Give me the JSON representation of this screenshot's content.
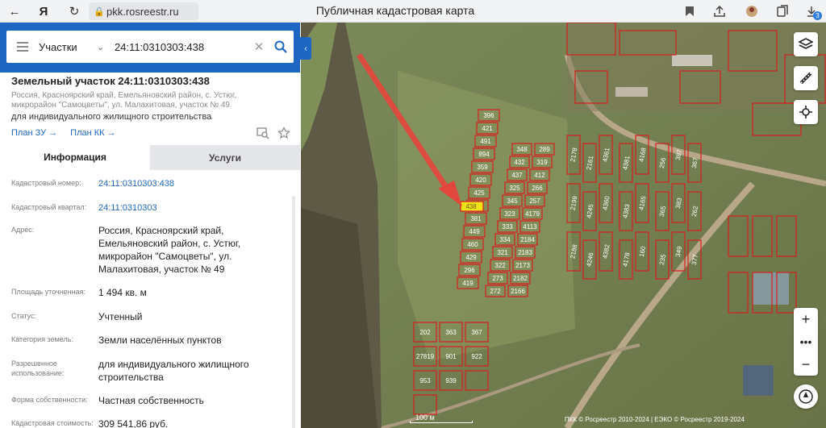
{
  "browser": {
    "url": "pkk.rosreestr.ru",
    "title": "Публичная кадастровая карта",
    "downloads_badge": "3"
  },
  "search": {
    "type_label": "Участки",
    "query": "24:11:0310303:438"
  },
  "parcel": {
    "title": "Земельный участок 24:11:0310303:438",
    "address_full": "Россия, Красноярский край, Емельяновский район, с. Устюг, микрорайон \"Самоцветы\", ул. Малахитовая, участок № 49",
    "permitted_use": "для индивидуального жилищного строительства",
    "plan_zu": "План ЗУ",
    "plan_kk": "План КК"
  },
  "tabs": {
    "info": "Информация",
    "services": "Услуги"
  },
  "info": [
    {
      "label": "Кадастровый номер:",
      "value": "24:11:0310303:438"
    },
    {
      "label": "Кадастровый квартал:",
      "value": "24:11:0310303"
    },
    {
      "label": "Адрес:",
      "value": "Россия, Красноярский край, Емельяновский район, с. Устюг, микрорайон \"Самоцветы\", ул. Малахитовая, участок № 49"
    },
    {
      "label": "Площадь уточненная:",
      "value": "1 494 кв. м"
    },
    {
      "label": "Статус:",
      "value": "Учтенный"
    },
    {
      "label": "Категория земель:",
      "value": "Земли населённых пунктов"
    },
    {
      "label": "Разрешенное использование:",
      "value": "для индивидуального жилищного строительства"
    },
    {
      "label": "Форма собственности:",
      "value": "Частная собственность"
    },
    {
      "label": "Кадастровая стоимость:",
      "value": "309 541,86 руб."
    }
  ],
  "map": {
    "scale_label": "100 м",
    "copyright": "ПКК © Росреестр 2010-2024 | ЕЭКО © Росреестр 2019-2024",
    "selected_parcel": "438",
    "parcel_labels": [
      "396",
      "421",
      "491",
      "894",
      "359",
      "420",
      "425",
      "441",
      "438",
      "381",
      "449",
      "460",
      "429",
      "296",
      "419",
      "348",
      "432",
      "437",
      "325",
      "345",
      "323",
      "333",
      "334",
      "321",
      "322",
      "273",
      "272",
      "289",
      "319",
      "412",
      "266",
      "257",
      "4179",
      "4113",
      "2184",
      "2183",
      "2173",
      "2182",
      "2166",
      "2178",
      "2199",
      "2188",
      "2161",
      "4245",
      "4246",
      "4361",
      "4360",
      "4382",
      "4381",
      "4383",
      "4178",
      "4168",
      "4165",
      "160",
      "256",
      "365",
      "235",
      "387",
      "383",
      "349",
      "367",
      "262",
      "377",
      "202",
      "363",
      "367",
      "27819",
      "901",
      "922",
      "953",
      "939"
    ]
  },
  "colors": {
    "header_blue": "#1d66c1",
    "link_blue": "#1d66c1",
    "parcel_border": "#d81e1e",
    "selected_parcel": "#f2e21a",
    "arrow": "#e5453c"
  }
}
